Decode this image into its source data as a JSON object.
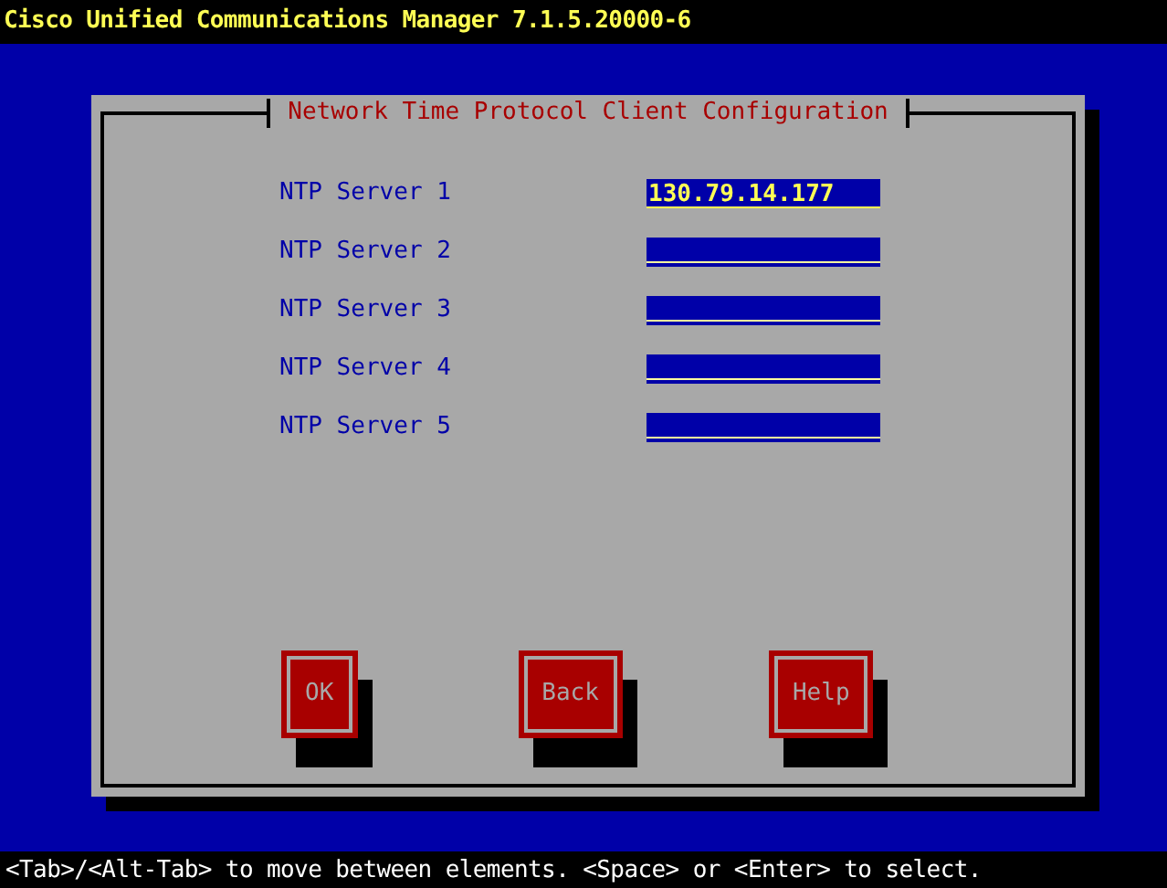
{
  "window": {
    "title": "Cisco Unified Communications Manager 7.1.5.20000-6"
  },
  "dialog": {
    "title": "Network Time Protocol Client Configuration",
    "fields": [
      {
        "label": "NTP Server 1",
        "value": "130.79.14.177",
        "focused": true
      },
      {
        "label": "NTP Server 2",
        "focused": false
      },
      {
        "label": "NTP Server 3",
        "focused": false
      },
      {
        "label": "NTP Server 4",
        "focused": false
      },
      {
        "label": "NTP Server 5",
        "focused": false
      }
    ],
    "buttons": [
      "OK",
      "Back",
      "Help"
    ]
  },
  "status_bar": "<Tab>/<Alt-Tab> to move between elements. <Space> or <Enter> to select."
}
